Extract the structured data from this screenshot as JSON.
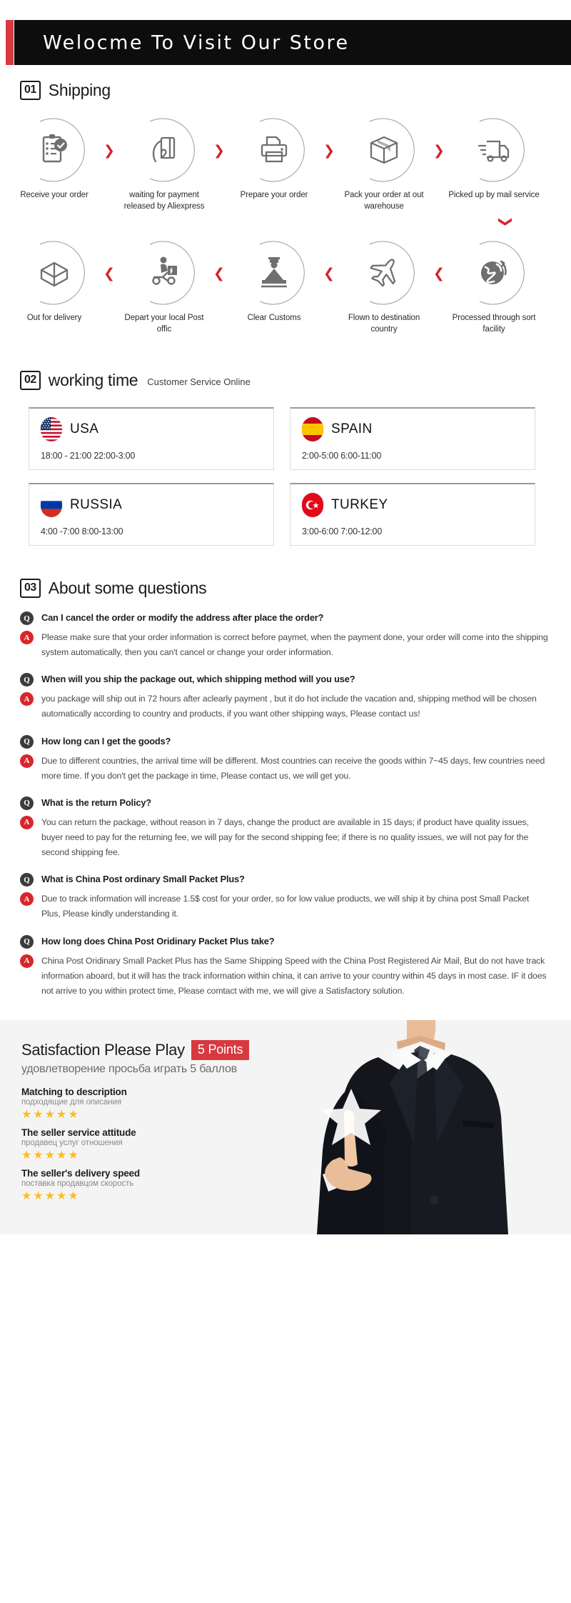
{
  "header": {
    "title": "Welocme To Visit Our Store",
    "accent_color": "#d93a40",
    "bg_color": "#0d0d0d"
  },
  "shipping": {
    "num": "01",
    "title": "Shipping",
    "arrow_right": "❯",
    "arrow_left": "❮",
    "arrow_down": "❯",
    "row1": [
      {
        "icon": "clipboard-check-icon",
        "label": "Receive your order"
      },
      {
        "icon": "hand-card-icon",
        "label": "waiting for payment released by Aliexpress"
      },
      {
        "icon": "printer-icon",
        "label": "Prepare your order"
      },
      {
        "icon": "box-icon",
        "label": "Pack your order at out warehouse"
      },
      {
        "icon": "truck-icon",
        "label": "Picked up by mail service"
      }
    ],
    "row2": [
      {
        "icon": "open-box-icon",
        "label": "Out  for delivery"
      },
      {
        "icon": "scooter-courier-icon",
        "label": "Depart your local Post offic"
      },
      {
        "icon": "customs-officer-icon",
        "label": "Clear Customs"
      },
      {
        "icon": "airplane-icon",
        "label": "Flown to destination country"
      },
      {
        "icon": "globe-icon",
        "label": "Processed through sort facility"
      }
    ]
  },
  "working_time": {
    "num": "02",
    "title": "working time",
    "subtitle": "Customer Service Online",
    "cards": [
      {
        "flag": "flag-usa",
        "country": "USA",
        "hours": "18:00 - 21:00   22:00-3:00"
      },
      {
        "flag": "flag-spain",
        "country": "SPAIN",
        "hours": "2:00-5:00    6:00-11:00"
      },
      {
        "flag": "flag-russia",
        "country": "RUSSIA",
        "hours": "4:00 -7:00   8:00-13:00"
      },
      {
        "flag": "flag-turkey",
        "country": "TURKEY",
        "hours": "3:00-6:00    7:00-12:00"
      }
    ]
  },
  "faq": {
    "num": "03",
    "title": "About some questions",
    "q_badge": "Q",
    "a_badge": "A",
    "items": [
      {
        "q": "Can I cancel the order or modify the address after place the order?",
        "a": "Please make sure that your order information is correct before paymet, when the payment done, your order will come into the shipping system automatically, then you can't cancel or change your order information."
      },
      {
        "q": "When will you ship the package out, which shipping method will you use?",
        "a": "you package will ship out in 72 hours after aclearly payment , but it do hot include the vacation and, shipping method will be chosen automatically according to country and products, if you want other shipping ways, Please contact us!"
      },
      {
        "q": "How long can I get the goods?",
        "a": "Due to different countries, the arrival time will be different. Most countries can receive the goods within 7~45 days, few countries need more time. If you don't get the package in time, Please contact us, we will get you."
      },
      {
        "q": "What is the return Policy?",
        "a": "You can return the package, without reason in 7 days, change the product are available in 15 days; if product have quality issues, buyer need to pay for the returning fee, we will pay for the second shipping fee; if there is no quality issues, we will not pay for the second shipping fee."
      },
      {
        "q": "What is China Post ordinary Small Packet Plus?",
        "a": "Due to track information will increase 1.5$ cost for your order, so for low value products, we will ship it by china post Small Packet Plus, Please kindly understanding it."
      },
      {
        "q": "How long does China Post Oridinary Packet Plus take?",
        "a": "China Post Oridinary Small Packet Plus has the Same Shipping Speed with the China Post Registered Air Mail, But do not have track information aboard, but it will has the track information within china, it can arrive to your country within 45 days in most case. IF it does not arrive to you within protect time, Please comtact with me, we will give a Satisfactory solution."
      }
    ]
  },
  "footer": {
    "title": "Satisfaction Please Play",
    "points_badge": "5 Points",
    "subtitle": "удовлетворение просьба играть 5 баллов",
    "badge_color": "#d8393f",
    "star_color": "#fbbe1e",
    "stars_glyph": "★★★★★",
    "ratings": [
      {
        "name": "Matching to description",
        "sub": "подходящие для описания",
        "stars": 5
      },
      {
        "name": "The seller service attitude",
        "sub": "продавец услуг отношения",
        "stars": 5
      },
      {
        "name": "The seller's delivery speed",
        "sub": "поставка продавцом скорость",
        "stars": 5
      }
    ]
  }
}
